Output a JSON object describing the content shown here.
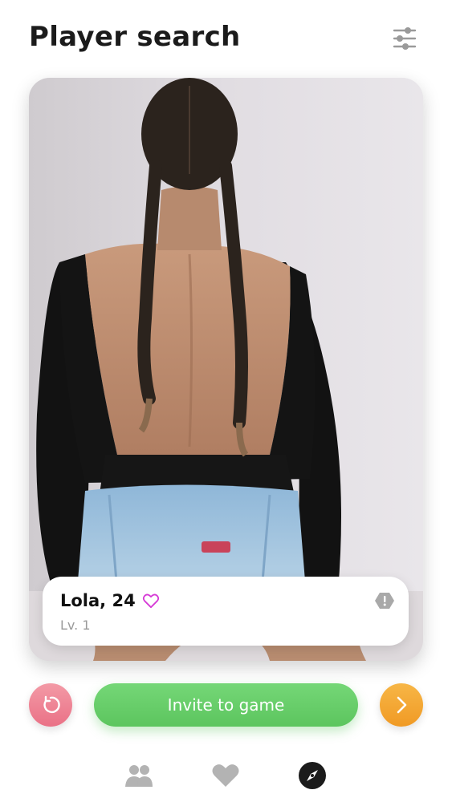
{
  "header": {
    "title": "Player search",
    "filter_icon": "sliders-icon"
  },
  "profile": {
    "name_age": "Lola, 24",
    "level": "Lv. 1",
    "like_icon": "heart-outline-icon",
    "report_icon": "alert-hexagon-icon"
  },
  "actions": {
    "undo_icon": "undo-icon",
    "invite_label": "Invite to game",
    "next_icon": "chevron-right-icon"
  },
  "bottom_nav": {
    "items": [
      {
        "icon": "users-icon",
        "active": false
      },
      {
        "icon": "heart-icon",
        "active": false
      },
      {
        "icon": "compass-icon",
        "active": true
      }
    ]
  },
  "colors": {
    "undo": "#ea7186",
    "invite": "#5cc55e",
    "next": "#f09a25",
    "like": "#d63ad6",
    "nav_inactive": "#b3b3b3",
    "nav_active": "#1b1b1b"
  }
}
